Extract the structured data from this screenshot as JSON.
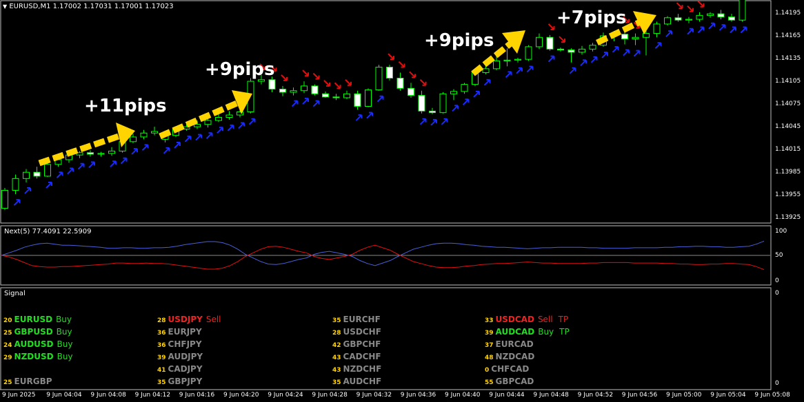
{
  "window": {
    "title": "EURUSD,M1  1.17002 1.17031 1.17001 1.17023",
    "menu_icon": "triangle-down-icon"
  },
  "price_axis": [
    "1.14195",
    "1.14165",
    "1.14135",
    "1.14105",
    "1.14075",
    "1.14045",
    "1.14015",
    "1.13985",
    "1.13955",
    "1.13925"
  ],
  "annotations": [
    "+11pips",
    "+9pips",
    "+9pips",
    "+7pips"
  ],
  "indicator": {
    "title": "Next(5) 77.4091 22.5909",
    "levels": [
      "100",
      "50",
      "0"
    ],
    "colors": {
      "line1": "#4a5fd8",
      "line2": "#e01010",
      "level": "#8a8a8a"
    }
  },
  "signal_panel": {
    "title": "Signal",
    "levels": [
      "0",
      "0"
    ],
    "columns": [
      [
        {
          "num": "20",
          "pair": "EURUSD",
          "status": "Buy",
          "tp": "",
          "color": "#22dd22"
        },
        {
          "num": "25",
          "pair": "GBPUSD",
          "status": "Buy",
          "tp": "",
          "color": "#22dd22"
        },
        {
          "num": "24",
          "pair": "AUDUSD",
          "status": "Buy",
          "tp": "",
          "color": "#22dd22"
        },
        {
          "num": "29",
          "pair": "NZDUSD",
          "status": "Buy",
          "tp": "",
          "color": "#22dd22"
        },
        {
          "num": "",
          "pair": "",
          "status": "",
          "tp": "",
          "color": "#888888"
        },
        {
          "num": "25",
          "pair": "EURGBP",
          "status": "",
          "tp": "",
          "color": "#888888"
        }
      ],
      [
        {
          "num": "28",
          "pair": "USDJPY",
          "status": "Sell",
          "tp": "",
          "color": "#ee2222"
        },
        {
          "num": "36",
          "pair": "EURJPY",
          "status": "",
          "tp": "",
          "color": "#888888"
        },
        {
          "num": "36",
          "pair": "CHFJPY",
          "status": "",
          "tp": "",
          "color": "#888888"
        },
        {
          "num": "39",
          "pair": "AUDJPY",
          "status": "",
          "tp": "",
          "color": "#888888"
        },
        {
          "num": "41",
          "pair": "CADJPY",
          "status": "",
          "tp": "",
          "color": "#888888"
        },
        {
          "num": "35",
          "pair": "GBPJPY",
          "status": "",
          "tp": "",
          "color": "#888888"
        }
      ],
      [
        {
          "num": "35",
          "pair": "EURCHF",
          "status": "",
          "tp": "",
          "color": "#888888"
        },
        {
          "num": "28",
          "pair": "USDCHF",
          "status": "",
          "tp": "",
          "color": "#888888"
        },
        {
          "num": "42",
          "pair": "GBPCHF",
          "status": "",
          "tp": "",
          "color": "#888888"
        },
        {
          "num": "43",
          "pair": "CADCHF",
          "status": "",
          "tp": "",
          "color": "#888888"
        },
        {
          "num": "43",
          "pair": "NZDCHF",
          "status": "",
          "tp": "",
          "color": "#888888"
        },
        {
          "num": "35",
          "pair": "AUDCHF",
          "status": "",
          "tp": "",
          "color": "#888888"
        }
      ],
      [
        {
          "num": "33",
          "pair": "USDCAD",
          "status": "Sell",
          "tp": "TP",
          "color": "#ee2222"
        },
        {
          "num": "39",
          "pair": "AUDCAD",
          "status": "Buy",
          "tp": "TP",
          "color": "#22dd22"
        },
        {
          "num": "37",
          "pair": "EURCAD",
          "status": "",
          "tp": "",
          "color": "#888888"
        },
        {
          "num": "48",
          "pair": "NZDCAD",
          "status": "",
          "tp": "",
          "color": "#888888"
        },
        {
          "num": "0",
          "pair": "CHFCAD",
          "status": "",
          "tp": "",
          "color": "#888888"
        },
        {
          "num": "55",
          "pair": "GBPCAD",
          "status": "",
          "tp": "",
          "color": "#888888"
        }
      ]
    ]
  },
  "time_axis": [
    "9 Jun 2025",
    "9 Jun 04:04",
    "9 Jun 04:08",
    "9 Jun 04:12",
    "9 Jun 04:16",
    "9 Jun 04:20",
    "9 Jun 04:24",
    "9 Jun 04:28",
    "9 Jun 04:32",
    "9 Jun 04:36",
    "9 Jun 04:40",
    "9 Jun 04:44",
    "9 Jun 04:48",
    "9 Jun 04:52",
    "9 Jun 04:56",
    "9 Jun 05:00",
    "9 Jun 05:04",
    "9 Jun 05:08"
  ],
  "chart_data": {
    "type": "candlestick",
    "symbol": "EURUSD",
    "timeframe": "M1",
    "ylim": [
      1.13925,
      1.14205
    ],
    "bull_color": "#00ff00",
    "bear_fill": "#ffffff",
    "up_arrow_color": "#1a2bff",
    "down_arrow_color": "#e01010",
    "candles": [
      [
        1.13942,
        1.13968,
        1.1394,
        1.13965
      ],
      [
        1.13965,
        1.13985,
        1.1396,
        1.1398
      ],
      [
        1.1398,
        1.13992,
        1.13975,
        1.13988
      ],
      [
        1.13988,
        1.13995,
        1.1398,
        1.13983
      ],
      [
        1.13983,
        1.14,
        1.13982,
        1.13998
      ],
      [
        1.13998,
        1.14008,
        1.13995,
        1.14004
      ],
      [
        1.14004,
        1.14012,
        1.14,
        1.1401
      ],
      [
        1.1401,
        1.14015,
        1.14006,
        1.14013
      ],
      [
        1.14013,
        1.14016,
        1.14008,
        1.14011
      ],
      [
        1.14011,
        1.14014,
        1.14008,
        1.14012
      ],
      [
        1.14012,
        1.1402,
        1.14009,
        1.14015
      ],
      [
        1.14015,
        1.1403,
        1.14013,
        1.14027
      ],
      [
        1.14027,
        1.14037,
        1.14025,
        1.14033
      ],
      [
        1.14033,
        1.14042,
        1.1403,
        1.14038
      ],
      [
        1.14038,
        1.14046,
        1.14035,
        1.1404
      ],
      [
        1.1403,
        1.14038,
        1.14026,
        1.14035
      ],
      [
        1.14035,
        1.14045,
        1.14033,
        1.14043
      ],
      [
        1.14043,
        1.14052,
        1.14041,
        1.14046
      ],
      [
        1.14046,
        1.14054,
        1.14043,
        1.14049
      ],
      [
        1.14049,
        1.14058,
        1.14045,
        1.14054
      ],
      [
        1.14054,
        1.14062,
        1.14052,
        1.14058
      ],
      [
        1.14058,
        1.14066,
        1.14055,
        1.14061
      ],
      [
        1.14061,
        1.1407,
        1.14058,
        1.14065
      ],
      [
        1.14065,
        1.14108,
        1.14063,
        1.14104
      ],
      [
        1.14104,
        1.14112,
        1.141,
        1.14106
      ],
      [
        1.14106,
        1.1411,
        1.1409,
        1.14094
      ],
      [
        1.14094,
        1.14098,
        1.14085,
        1.1409
      ],
      [
        1.1409,
        1.14096,
        1.14086,
        1.14092
      ],
      [
        1.14092,
        1.14104,
        1.14089,
        1.14098
      ],
      [
        1.14098,
        1.141,
        1.14086,
        1.14088
      ],
      [
        1.14088,
        1.14091,
        1.14083,
        1.14084
      ],
      [
        1.14084,
        1.14088,
        1.1408,
        1.14083
      ],
      [
        1.14083,
        1.14092,
        1.14081,
        1.14088
      ],
      [
        1.14088,
        1.14092,
        1.14068,
        1.14072
      ],
      [
        1.14072,
        1.14095,
        1.14071,
        1.14093
      ],
      [
        1.14093,
        1.14125,
        1.14092,
        1.14122
      ],
      [
        1.14122,
        1.14125,
        1.14105,
        1.14108
      ],
      [
        1.14108,
        1.14115,
        1.14092,
        1.14095
      ],
      [
        1.14095,
        1.14102,
        1.14083,
        1.14086
      ],
      [
        1.14086,
        1.14092,
        1.14063,
        1.14066
      ],
      [
        1.14066,
        1.1407,
        1.14062,
        1.14064
      ],
      [
        1.14064,
        1.1409,
        1.14063,
        1.14088
      ],
      [
        1.14088,
        1.14094,
        1.1408,
        1.14091
      ],
      [
        1.14091,
        1.14102,
        1.14088,
        1.141
      ],
      [
        1.141,
        1.14118,
        1.14098,
        1.14115
      ],
      [
        1.14115,
        1.14125,
        1.14113,
        1.1412
      ],
      [
        1.1412,
        1.1414,
        1.14118,
        1.1413
      ],
      [
        1.1413,
        1.14146,
        1.14123,
        1.14131
      ],
      [
        1.14131,
        1.14134,
        1.14128,
        1.14132
      ],
      [
        1.14132,
        1.1415,
        1.1413,
        1.14148
      ],
      [
        1.14148,
        1.14165,
        1.14145,
        1.1416
      ],
      [
        1.1416,
        1.14163,
        1.14143,
        1.14145
      ],
      [
        1.14145,
        1.14147,
        1.14142,
        1.14144
      ],
      [
        1.14144,
        1.14146,
        1.14128,
        1.14141
      ],
      [
        1.14141,
        1.14149,
        1.14138,
        1.14145
      ],
      [
        1.14145,
        1.14153,
        1.14142,
        1.1415
      ],
      [
        1.1415,
        1.14166,
        1.14148,
        1.14162
      ],
      [
        1.14162,
        1.14168,
        1.14155,
        1.14164
      ],
      [
        1.14164,
        1.14172,
        1.14151,
        1.14158
      ],
      [
        1.14158,
        1.14165,
        1.1415,
        1.1416
      ],
      [
        1.1416,
        1.1417,
        1.14137,
        1.14165
      ],
      [
        1.14165,
        1.1418,
        1.1416,
        1.14177
      ],
      [
        1.14177,
        1.14187,
        1.14175,
        1.14185
      ],
      [
        1.14185,
        1.1419,
        1.1418,
        1.14182
      ],
      [
        1.14182,
        1.14186,
        1.14178,
        1.14183
      ],
      [
        1.14183,
        1.14192,
        1.1418,
        1.14188
      ],
      [
        1.14188,
        1.14192,
        1.14185,
        1.1419
      ],
      [
        1.1419,
        1.14195,
        1.14183,
        1.14186
      ],
      [
        1.14186,
        1.1419,
        1.1418,
        1.14182
      ],
      [
        1.14182,
        1.14228,
        1.1418,
        1.14222
      ]
    ],
    "up_arrows": [
      1,
      2,
      4,
      5,
      6,
      7,
      8,
      10,
      11,
      12,
      13,
      15,
      16,
      17,
      18,
      19,
      20,
      21,
      22,
      23,
      27,
      28,
      29,
      33,
      34,
      35,
      39,
      40,
      41,
      42,
      43,
      44,
      45,
      47,
      48,
      49,
      51,
      53,
      54,
      55,
      56,
      57,
      58,
      59,
      61,
      62,
      64,
      65,
      66,
      67,
      68,
      69
    ],
    "down_arrows": [
      24,
      25,
      26,
      28,
      29,
      30,
      31,
      32,
      36,
      37,
      38,
      39,
      47,
      51,
      52,
      58,
      59,
      60,
      63,
      64,
      65
    ],
    "indicator": {
      "ylim": [
        0,
        100
      ],
      "line1": [
        50,
        55,
        60,
        66,
        70,
        73,
        74,
        72,
        70,
        70,
        69,
        68,
        67,
        66,
        64,
        64,
        65,
        65,
        64,
        64,
        65,
        65,
        66,
        68,
        71,
        73,
        75,
        77,
        77,
        75,
        70,
        62,
        52,
        45,
        38,
        33,
        32,
        34,
        38,
        42,
        45,
        52,
        56,
        58,
        55,
        52,
        48,
        40,
        34,
        30,
        35,
        40,
        48,
        55,
        62,
        66,
        70,
        73,
        74,
        74,
        73,
        71,
        70,
        68,
        67,
        66,
        66,
        65,
        64,
        63,
        64,
        65,
        65,
        66,
        66,
        66,
        66,
        65,
        65,
        64,
        64,
        64,
        64,
        65,
        65,
        65,
        65,
        66,
        66,
        67,
        67,
        68,
        68,
        67,
        67,
        66,
        66,
        67,
        68,
        72,
        78
      ],
      "line2": [
        50,
        47,
        42,
        36,
        30,
        28,
        27,
        27,
        28,
        28,
        29,
        30,
        31,
        32,
        33,
        35,
        35,
        34,
        34,
        35,
        34,
        34,
        33,
        31,
        29,
        27,
        25,
        23,
        23,
        25,
        30,
        38,
        48,
        55,
        62,
        67,
        68,
        66,
        62,
        58,
        55,
        48,
        44,
        42,
        45,
        48,
        52,
        60,
        66,
        70,
        65,
        60,
        52,
        45,
        38,
        34,
        30,
        27,
        26,
        26,
        27,
        29,
        30,
        32,
        33,
        34,
        34,
        35,
        36,
        37,
        36,
        35,
        35,
        34,
        34,
        34,
        34,
        35,
        35,
        36,
        36,
        36,
        36,
        35,
        35,
        35,
        35,
        34,
        34,
        33,
        33,
        32,
        32,
        33,
        33,
        34,
        34,
        33,
        32,
        28,
        22
      ]
    }
  }
}
